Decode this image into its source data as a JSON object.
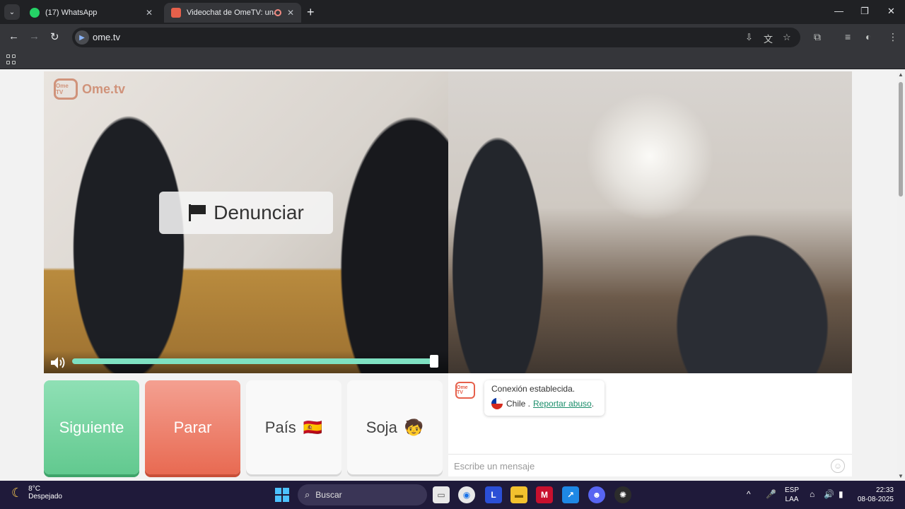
{
  "browser": {
    "tabs": [
      {
        "title": "(17) WhatsApp",
        "active": false
      },
      {
        "title": "Videochat de OmeTV: una alternativa",
        "active": true
      }
    ],
    "url": "ome.tv"
  },
  "watermark": "Ome.tv",
  "watermark_box": "Ome TV",
  "report_button": "Denunciar",
  "volume": {
    "level": 1.0
  },
  "controls": {
    "next": "Siguiente",
    "stop": "Parar",
    "country": "País",
    "country_emoji": "🇪🇸",
    "gender": "Soja",
    "gender_emoji": "🧒"
  },
  "chat": {
    "logo_text": "Ome TV",
    "status": "Conexión establecida.",
    "country": "Chile .",
    "report_link": "Reportar abuso",
    "report_link_suffix": ".",
    "placeholder": "Escribe un mensaje"
  },
  "taskbar": {
    "temperature": "8°C",
    "weather": "Despejado",
    "search": "Buscar",
    "lang_top": "ESP",
    "lang_bottom": "LAA",
    "time": "22:33",
    "date": "08-08-2025"
  },
  "colors": {
    "next": "#62c98f",
    "stop": "#e86a52",
    "accent": "#1b8e6b",
    "taskbar": "#1f1a3a"
  }
}
